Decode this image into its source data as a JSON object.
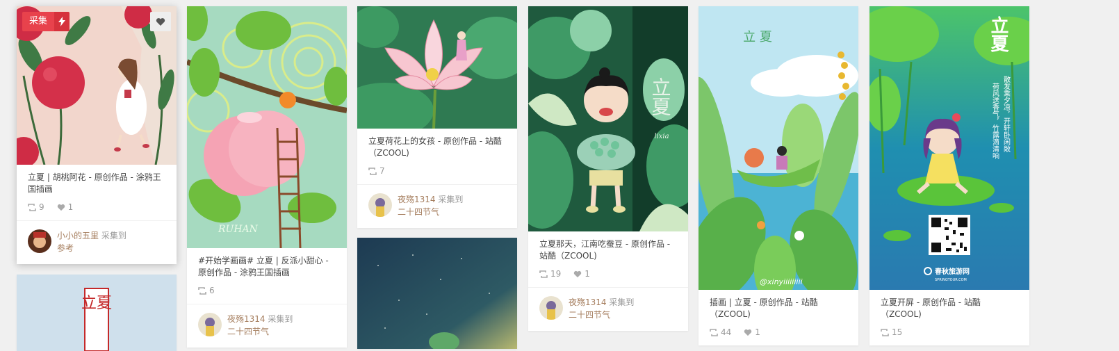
{
  "overlay": {
    "collect_label": "采集"
  },
  "pins": [
    {
      "title": "立夏 | 胡桃阿花 - 原创作品 - 涂鸦王国插画",
      "repins": "9",
      "likes": "1",
      "user": "小小的五里",
      "verb": "采集到",
      "board": "参考"
    },
    {
      "title": "#开始学画画# 立夏 | 反派小甜心 - 原创作品 - 涂鸦王国插画",
      "repins": "6",
      "user": "夜殇1314",
      "verb": "采集到",
      "board": "二十四节气"
    },
    {
      "title": "立夏荷花上的女孩 - 原创作品 - 站酷（ZCOOL)",
      "repins": "7",
      "user": "夜殇1314",
      "verb": "采集到",
      "board": "二十四节气"
    },
    {
      "title": "立夏那天，江南吃蚕豆 - 原创作品 - 站酷（ZCOOL)",
      "repins": "19",
      "likes": "1",
      "user": "夜殇1314",
      "verb": "采集到",
      "board": "二十四节气"
    },
    {
      "title": "插画 | 立夏 - 原创作品 - 站酷（ZCOOL)",
      "repins": "44",
      "likes": "1"
    },
    {
      "title": "立夏开屏 - 原创作品 - 站酷（ZCOOL)",
      "repins": "15"
    }
  ],
  "art_text": {
    "c1_lixia": "立夏",
    "c2_sign": "RUHAN",
    "c4_lixia": "立夏",
    "c4_sign": "lixia",
    "c5_lixia": "立 夏",
    "c5_sign": "@xinyiiiiiiiii",
    "c6_lixia": "立夏",
    "c6_poem": [
      "散发乘夕凉，开轩卧闲敞",
      "荷风送香气，竹露滴清响"
    ],
    "c6_brand": "春秋旅游网",
    "c6_brand_sub": "SPRINGTOUR.COM"
  },
  "colors": {
    "accent_red": "#e8424c",
    "link_brown": "#a57d5d",
    "muted": "#999999"
  }
}
